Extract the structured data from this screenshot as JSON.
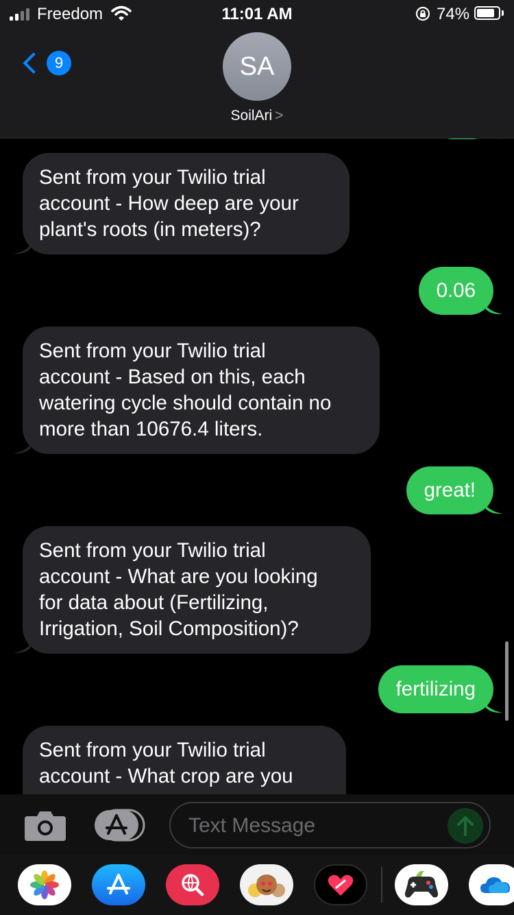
{
  "status_bar": {
    "carrier": "Freedom",
    "time": "11:01 AM",
    "battery_percent": "74%",
    "battery_level": 0.74,
    "signal_bars": 2,
    "icons": [
      "signal-icon",
      "wifi-icon",
      "rotation-lock-icon",
      "battery-icon"
    ]
  },
  "header": {
    "back_badge": "9",
    "avatar_initials": "SA",
    "contact_name": "SoilAri",
    "contact_chevron": ">"
  },
  "messages": [
    {
      "direction": "incoming",
      "lines": [
        "Sent from your Twilio trial",
        "account - How deep are your",
        "plant's roots (in meters)?"
      ]
    },
    {
      "direction": "outgoing",
      "lines": [
        "0.06"
      ]
    },
    {
      "direction": "incoming",
      "lines": [
        "Sent from your Twilio trial",
        "account - Based on this, each",
        "watering cycle should contain no",
        "more than 10676.4 liters."
      ]
    },
    {
      "direction": "outgoing",
      "lines": [
        "great!"
      ]
    },
    {
      "direction": "incoming",
      "lines": [
        "Sent from your Twilio trial",
        "account - What are you looking",
        "for data about (Fertilizing,",
        "Irrigation, Soil Composition)?"
      ]
    },
    {
      "direction": "outgoing",
      "lines": [
        "fertilizing"
      ]
    },
    {
      "direction": "incoming",
      "lines": [
        "Sent from your Twilio trial",
        "account - What crop are you"
      ]
    }
  ],
  "input_bar": {
    "placeholder": "Text Message",
    "icons": [
      "camera-icon",
      "app-store-icon",
      "send-arrow-icon"
    ]
  },
  "app_drawer": {
    "apps": [
      "photos-icon",
      "app-store-icon",
      "web-search-icon",
      "memoji-icon",
      "digital-touch-icon",
      "game-icon",
      "onedrive-icon"
    ]
  },
  "colors": {
    "incoming_bubble": "#26252a",
    "outgoing_bubble": "#34c759",
    "accent": "#0a84ff",
    "header_bg": "#1c1c1e"
  }
}
